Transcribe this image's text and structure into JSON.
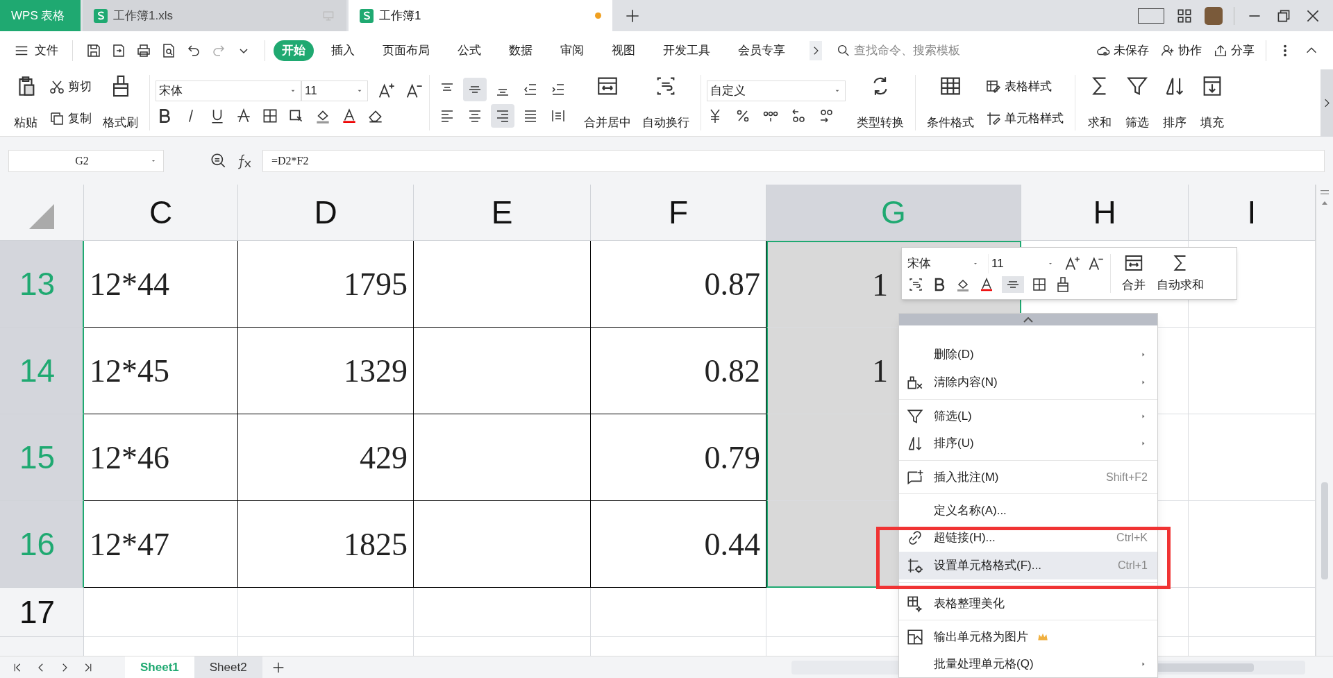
{
  "app_tabs": [
    {
      "label": "WPS 表格",
      "kind": "home",
      "selected": false
    },
    {
      "label": "工作簿1.xls",
      "kind": "doc",
      "selected": false,
      "unsaved": false
    },
    {
      "label": "工作簿1",
      "kind": "doc",
      "selected": true,
      "unsaved": true
    }
  ],
  "menu": {
    "file": "文件",
    "tabs": [
      {
        "label": "开始",
        "selected": true
      },
      {
        "label": "插入",
        "selected": false
      },
      {
        "label": "页面布局",
        "selected": false
      },
      {
        "label": "公式",
        "selected": false
      },
      {
        "label": "数据",
        "selected": false
      },
      {
        "label": "审阅",
        "selected": false
      },
      {
        "label": "视图",
        "selected": false
      },
      {
        "label": "开发工具",
        "selected": false
      },
      {
        "label": "会员专享",
        "selected": false
      }
    ],
    "search": {
      "placeholder": "查找命令、搜索模板"
    },
    "save_status": "未保存",
    "collaborate": "协作",
    "share": "分享"
  },
  "ribbon": {
    "paste": "粘贴",
    "cut": "剪切",
    "copy": "复制",
    "format_painter": "格式刷",
    "font_name": "宋体",
    "font_size": "11",
    "align_buttons": [
      {
        "kind": "top",
        "selected": false
      },
      {
        "kind": "middle",
        "selected": true
      },
      {
        "kind": "bottom",
        "selected": false
      },
      {
        "kind": "outdent",
        "selected": false
      },
      {
        "kind": "indent",
        "selected": false
      },
      {
        "kind": "left",
        "selected": false
      },
      {
        "kind": "center",
        "selected": false
      },
      {
        "kind": "right",
        "selected": true
      },
      {
        "kind": "justify",
        "selected": false
      },
      {
        "kind": "distribute",
        "selected": false
      }
    ],
    "merge": "合并居中",
    "wrap": "自动换行",
    "number_format": "自定义",
    "convert": "类型转换",
    "conditional_format": "条件格式",
    "table_style": "表格样式",
    "cell_style": "单元格样式",
    "editing": [
      {
        "kind": "sum",
        "label": "求和"
      },
      {
        "kind": "filter",
        "label": "筛选"
      },
      {
        "kind": "sort",
        "label": "排序"
      },
      {
        "kind": "fill",
        "label": "填充"
      }
    ]
  },
  "formula_bar": {
    "name_box": "G2",
    "formula": "=D2*F2"
  },
  "sheet": {
    "columns": [
      {
        "label": "C",
        "selected": false
      },
      {
        "label": "D",
        "selected": false
      },
      {
        "label": "E",
        "selected": false
      },
      {
        "label": "F",
        "selected": false
      },
      {
        "label": "G",
        "selected": true
      },
      {
        "label": "H",
        "selected": false
      },
      {
        "label": "I",
        "selected": false
      }
    ],
    "rows": [
      {
        "header": "13",
        "selected": true,
        "cells": [
          {
            "text": "12*44",
            "kind": "text"
          },
          {
            "text": "1795",
            "kind": "number"
          },
          {},
          {
            "text": "0.87",
            "kind": "number"
          },
          {
            "text": "1",
            "kind": "partial"
          },
          {},
          {}
        ]
      },
      {
        "header": "14",
        "selected": true,
        "cells": [
          {
            "text": "12*45",
            "kind": "text"
          },
          {
            "text": "1329",
            "kind": "number"
          },
          {},
          {
            "text": "0.82",
            "kind": "number"
          },
          {
            "text": "1",
            "kind": "partial"
          },
          {},
          {}
        ]
      },
      {
        "header": "15",
        "selected": true,
        "cells": [
          {
            "text": "12*46",
            "kind": "text"
          },
          {
            "text": "429",
            "kind": "number"
          },
          {},
          {
            "text": "0.79",
            "kind": "number"
          },
          {},
          {},
          {}
        ]
      },
      {
        "header": "16",
        "selected": true,
        "cells": [
          {
            "text": "12*47",
            "kind": "text"
          },
          {
            "text": "1825",
            "kind": "number"
          },
          {},
          {
            "text": "0.44",
            "kind": "number"
          },
          {},
          {},
          {}
        ]
      },
      {
        "header": "17",
        "selected": false,
        "cells": [
          {},
          {},
          {},
          {},
          {},
          {},
          {}
        ]
      }
    ]
  },
  "mini_toolbar": {
    "font_name": "宋体",
    "font_size": "11",
    "merge": "合并",
    "autosum": "自动求和"
  },
  "context_menu": [
    {
      "kind": "delete",
      "label": "删除(D)",
      "submenu": true,
      "separator_before": false,
      "selected": false
    },
    {
      "kind": "clear",
      "label": "清除内容(N)",
      "submenu": true,
      "separator_before": false,
      "selected": false
    },
    {
      "kind": "filter",
      "label": "筛选(L)",
      "submenu": true,
      "separator_before": true,
      "selected": false
    },
    {
      "kind": "sort",
      "label": "排序(U)",
      "submenu": true,
      "separator_before": false,
      "selected": false
    },
    {
      "kind": "comment",
      "label": "插入批注(M)",
      "shortcut": "Shift+F2",
      "submenu": false,
      "separator_before": true,
      "selected": false
    },
    {
      "kind": "name",
      "label": "定义名称(A)...",
      "submenu": false,
      "separator_before": true,
      "selected": false
    },
    {
      "kind": "link",
      "label": "超链接(H)...",
      "shortcut": "Ctrl+K",
      "submenu": false,
      "separator_before": false,
      "selected": false
    },
    {
      "kind": "format",
      "label": "设置单元格格式(F)...",
      "shortcut": "Ctrl+1",
      "submenu": false,
      "separator_before": false,
      "selected": true
    },
    {
      "kind": "tidy",
      "label": "表格整理美化",
      "submenu": false,
      "separator_before": true,
      "selected": false
    },
    {
      "kind": "export",
      "label": "输出单元格为图片",
      "premium": true,
      "submenu": false,
      "separator_before": true,
      "selected": false
    },
    {
      "kind": "batch",
      "label": "批量处理单元格(Q)",
      "submenu": true,
      "separator_before": false,
      "selected": false
    }
  ],
  "sheet_tabs": [
    {
      "label": "Sheet1",
      "selected": true
    },
    {
      "label": "Sheet2",
      "selected": false
    }
  ]
}
